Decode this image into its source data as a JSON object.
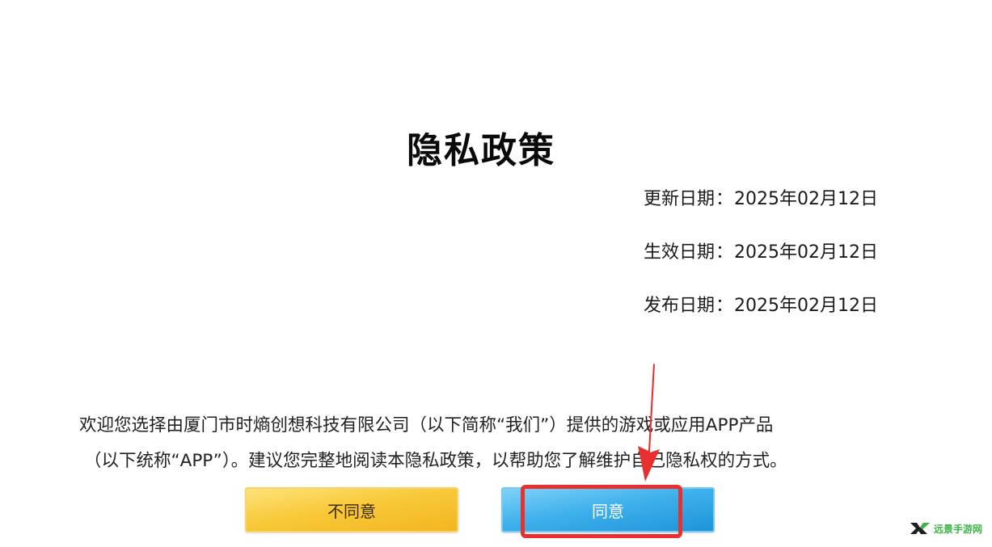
{
  "title": "隐私政策",
  "dates": {
    "updated": {
      "label": "更新日期",
      "sep": "：",
      "value": "2025年02月12日"
    },
    "effective": {
      "label": "生效日期",
      "sep": "：",
      "value": "2025年02月12日"
    },
    "published": {
      "label": "发布日期",
      "sep": "：",
      "value": "2025年02月12日"
    }
  },
  "intro": {
    "line1": "欢迎您选择由厦门市时熵创想科技有限公司（以下简称“我们”）提供的游戏或应用APP产品",
    "line2": "（以下统称“APP”）。建议您完整地阅读本隐私政策，以帮助您了解维护自己隐私权的方式。"
  },
  "buttons": {
    "disagree_label": "不同意",
    "agree_label": "同意"
  },
  "annotation": {
    "color": "#e8312f"
  },
  "watermark": {
    "text": "远景手游网",
    "color": "#3fb548"
  },
  "colors": {
    "disagree_button": "#f8c93a",
    "agree_button": "#3fb1ec"
  }
}
